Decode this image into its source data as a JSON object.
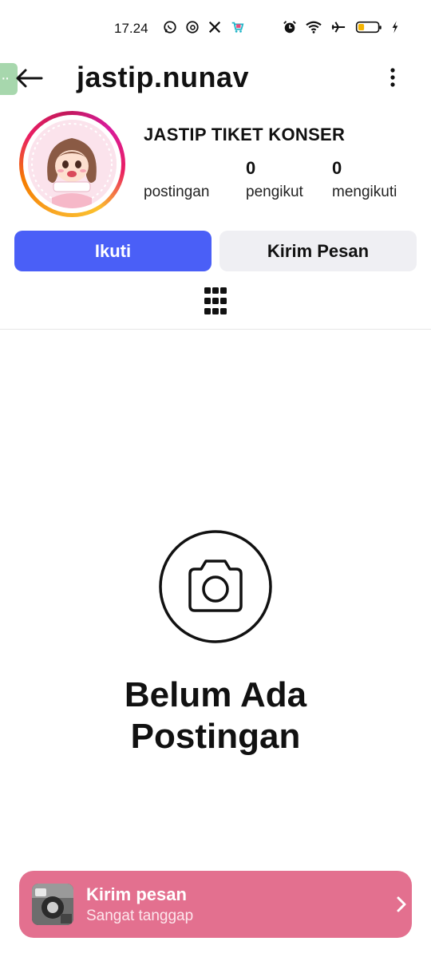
{
  "status_bar": {
    "time": "17.24",
    "left_icons": [
      "whatsapp-icon",
      "threads-icon",
      "x-icon",
      "shop-icon"
    ],
    "right_icons": [
      "alarm-icon",
      "wifi-icon",
      "airplane-icon",
      "battery-icon",
      "charging-icon"
    ]
  },
  "header": {
    "username": "jastip.nunav"
  },
  "profile": {
    "display_name": "JASTIP TIKET KONSER",
    "stats": {
      "posts_label": "postingan",
      "followers_value": "0",
      "followers_label": "pengikut",
      "following_value": "0",
      "following_label": "mengikuti"
    }
  },
  "actions": {
    "follow_label": "Ikuti",
    "message_label": "Kirim Pesan"
  },
  "empty_state": {
    "title_line1": "Belum Ada",
    "title_line2": "Postingan"
  },
  "promo": {
    "title": "Kirim pesan",
    "subtitle": "Sangat tanggap"
  },
  "colors": {
    "follow_button": "#4a5ff7",
    "message_button": "#efeff3",
    "promo_background": "#e3708f"
  }
}
